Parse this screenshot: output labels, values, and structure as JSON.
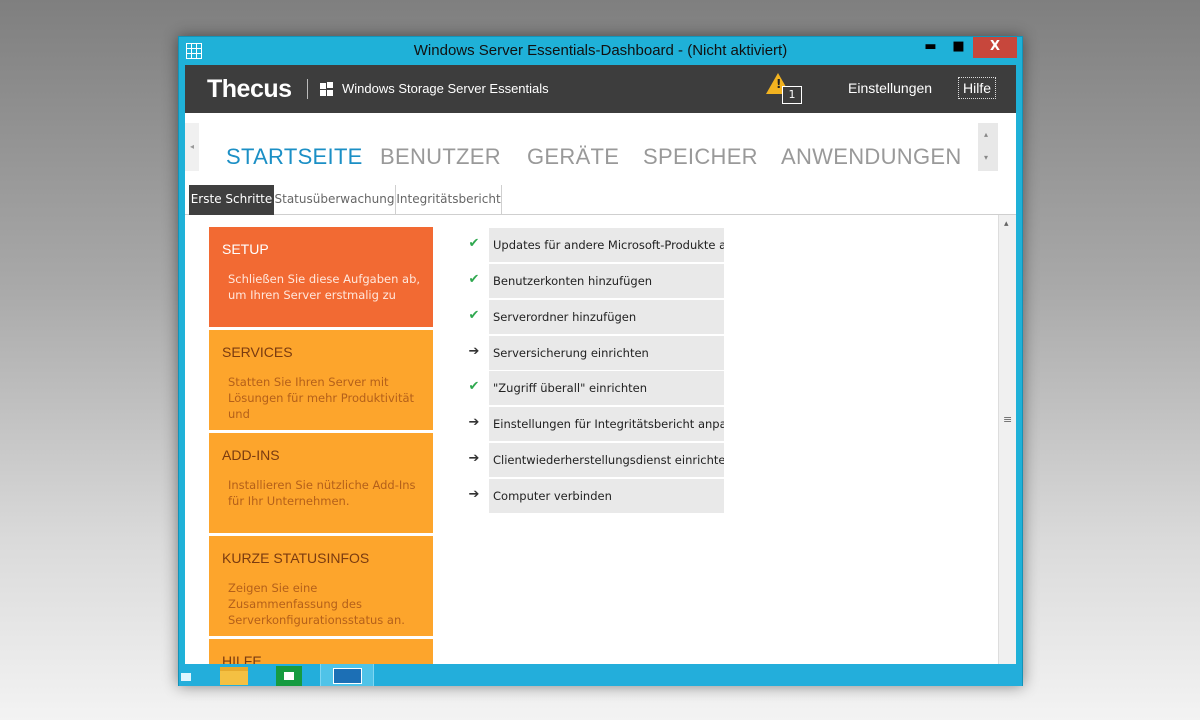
{
  "window": {
    "title": "Windows Server Essentials-Dashboard - (Nicht aktiviert)",
    "minimize_glyph": "▬",
    "maximize_glyph": "■",
    "close_glyph": "X"
  },
  "brand": {
    "logo": "Thecus",
    "product": "Windows Storage Server Essentials",
    "alert_count": "1",
    "links": {
      "settings": "Einstellungen",
      "help": "Hilfe"
    }
  },
  "main_tabs": [
    {
      "label": "STARTSEITE",
      "active": true
    },
    {
      "label": "BENUTZER",
      "active": false
    },
    {
      "label": "GERÄTE",
      "active": false
    },
    {
      "label": "SPEICHER",
      "active": false
    },
    {
      "label": "ANWENDUNGEN",
      "active": false
    }
  ],
  "sub_tabs": [
    {
      "label": "Erste Schritte",
      "active": true
    },
    {
      "label": "Statusüberwachung",
      "active": false
    },
    {
      "label": "Integritätsbericht",
      "active": false
    }
  ],
  "tiles": [
    {
      "title": "SETUP",
      "description": "Schließen Sie diese Aufgaben ab, um Ihren Server erstmalig zu"
    },
    {
      "title": "SERVICES",
      "description": "Statten Sie Ihren Server mit Lösungen für mehr Produktivität und"
    },
    {
      "title": "ADD-INS",
      "description": "Installieren Sie nützliche Add-Ins für Ihr Unternehmen."
    },
    {
      "title": "KURZE STATUSINFOS",
      "description": "Zeigen Sie eine Zusammenfassung des Serverkonfigurationsstatus an."
    },
    {
      "title": "HILFE",
      "description": ""
    }
  ],
  "tasks": [
    {
      "label": "Updates für andere Microsoft-Produkte ab...",
      "status": "check"
    },
    {
      "label": "Benutzerkonten hinzufügen",
      "status": "check"
    },
    {
      "label": "Serverordner hinzufügen",
      "status": "check"
    },
    {
      "label": "Serversicherung einrichten",
      "status": "arrow"
    },
    {
      "label": "\"Zugriff überall\" einrichten",
      "status": "check"
    },
    {
      "label": "Einstellungen für Integritätsbericht anpassen",
      "status": "arrow"
    },
    {
      "label": "Clientwiederherstellungsdienst einrichten",
      "status": "arrow"
    },
    {
      "label": "Computer verbinden",
      "status": "arrow"
    }
  ],
  "icons": {
    "check": "✔",
    "arrow": "➔",
    "alert": "!",
    "scroll_left": "◂",
    "scroll_up": "▴",
    "scroll_down": "▾",
    "grip": "≡"
  },
  "colors": {
    "titlebar": "#1fb1d8",
    "setup_tile": "#f26a33",
    "tile": "#fda52c",
    "active_tab": "#1b8fc5",
    "brandbar": "#3d3d3d"
  }
}
